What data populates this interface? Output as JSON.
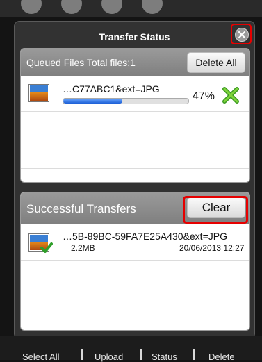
{
  "background": {
    "top_icons": [
      "settings-icon",
      "menu-icon",
      "refresh-icon",
      "check-icon"
    ],
    "bottom_bar": [
      "Select All",
      "Upload",
      "Status",
      "Delete"
    ]
  },
  "dialog": {
    "title": "Transfer Status",
    "close_icon": "close-icon"
  },
  "queued": {
    "title": "Queued Files Total files:1",
    "delete_all_label": "Delete All",
    "items": [
      {
        "name": "…C77ABC1&ext=JPG",
        "percent_text": "47%",
        "progress": 0.47
      }
    ]
  },
  "success": {
    "title": "Successful Transfers",
    "clear_label": "Clear",
    "items": [
      {
        "name": "…5B-89BC-59FA7E25A430&ext=JPG",
        "size": "2.2MB",
        "date": "20/06/2013 12:27"
      }
    ]
  },
  "colors": {
    "highlight": "#e60000",
    "progress": "#1b5fd6"
  }
}
